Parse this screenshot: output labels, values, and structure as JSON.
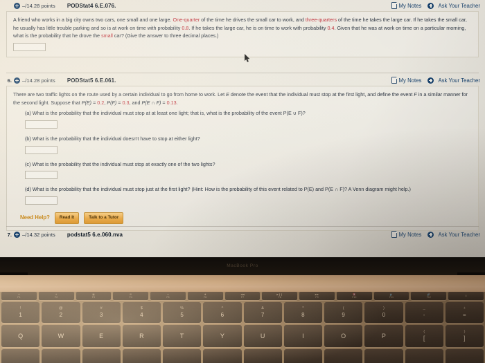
{
  "screen": {
    "questions": [
      {
        "number": "",
        "points": "–/14.28 points",
        "title": "PODStat4 6.E.076.",
        "my_notes": "My Notes",
        "ask_teacher": "Ask Your Teacher",
        "body_parts": [
          {
            "t": "A friend who works in a big city owns two cars, one small and one large. ",
            "style": "plain"
          },
          {
            "t": "One-quarter",
            "style": "hl"
          },
          {
            "t": " of the time he drives the small car to work, and ",
            "style": "plain"
          },
          {
            "t": "three-quarters",
            "style": "hl"
          },
          {
            "t": " of the time he takes the large car. If he takes the small car, he usually has little trouble parking and so is at work on time with probability ",
            "style": "plain"
          },
          {
            "t": "0.8",
            "style": "hl"
          },
          {
            "t": ". If he takes the large car, he is on time to work with probability ",
            "style": "plain"
          },
          {
            "t": "0.4",
            "style": "hl"
          },
          {
            "t": ". Given that he was at work on time on a particular morning, what is the probability that he drove the ",
            "style": "plain"
          },
          {
            "t": "small",
            "style": "hl"
          },
          {
            "t": " car? (Give the answer to three decimal places.)",
            "style": "plain"
          }
        ],
        "answer_value": ""
      },
      {
        "number": "6.",
        "points": "–/14.28 points",
        "title": "PODStat5 6.E.061.",
        "my_notes": "My Notes",
        "ask_teacher": "Ask Your Teacher",
        "intro_parts": [
          {
            "t": "There are two traffic lights on the route used by a certain individual to go from home to work. Let ",
            "style": "plain"
          },
          {
            "t": "E",
            "style": "it"
          },
          {
            "t": " denote the event that the individual must stop at the first light, and define the event ",
            "style": "plain"
          },
          {
            "t": "F",
            "style": "it"
          },
          {
            "t": " in a similar manner for the second light. Suppose that ",
            "style": "plain"
          },
          {
            "t": "P(E)",
            "style": "it"
          },
          {
            "t": " = ",
            "style": "plain"
          },
          {
            "t": "0.2",
            "style": "hl"
          },
          {
            "t": ", ",
            "style": "plain"
          },
          {
            "t": "P(F)",
            "style": "it"
          },
          {
            "t": " = ",
            "style": "plain"
          },
          {
            "t": "0.3",
            "style": "hl"
          },
          {
            "t": ", and ",
            "style": "plain"
          },
          {
            "t": "P(E ∩ F)",
            "style": "it"
          },
          {
            "t": " = ",
            "style": "plain"
          },
          {
            "t": "0.13",
            "style": "hl"
          },
          {
            "t": ".",
            "style": "plain"
          }
        ],
        "parts": [
          {
            "label": "(a)",
            "text": "What is the probability that the individual must stop at at least one light; that is, what is the probability of the event P(E ∪ F)?",
            "answer_value": ""
          },
          {
            "label": "(b)",
            "text": "What is the probability that the individual doesn't have to stop at either light?",
            "answer_value": ""
          },
          {
            "label": "(c)",
            "text": "What is the probability that the individual must stop at exactly one of the two lights?",
            "answer_value": ""
          },
          {
            "label": "(d)",
            "text": "What is the probability that the individual must stop just at the first light? (Hint: How is the probability of this event related to P(E) and P(E ∩ F)? A Venn diagram might help.)",
            "answer_value": ""
          }
        ],
        "need_help_label": "Need Help?",
        "help_buttons": [
          "Read It",
          "Talk to a Tutor"
        ]
      },
      {
        "number": "7.",
        "points": "–/14.32 points",
        "title": "podstat5 6.e.060.nva",
        "my_notes": "My Notes",
        "ask_teacher": "Ask Your Teacher"
      }
    ],
    "colors": {
      "highlight": "#bf2f3a",
      "link": "#17406b",
      "need_help": "#c98a1c"
    }
  },
  "laptop": {
    "bezel_label": "MacBook Pro",
    "fn_row": [
      {
        "glyph": "☀",
        "label": "F1"
      },
      {
        "glyph": "☀",
        "label": "F2"
      },
      {
        "glyph": "▦",
        "label": "F3"
      },
      {
        "glyph": "⊞",
        "label": "F4"
      },
      {
        "glyph": "✶",
        "label": "F5"
      },
      {
        "glyph": "✸",
        "label": "F6"
      },
      {
        "glyph": "◀◀",
        "label": "F7"
      },
      {
        "glyph": "▶❙❙",
        "label": "F8"
      },
      {
        "glyph": "▶▶",
        "label": "F9"
      },
      {
        "glyph": "🔇",
        "label": "F10"
      },
      {
        "glyph": "🔉",
        "label": "F11"
      },
      {
        "glyph": "🔊",
        "label": "F12"
      },
      {
        "glyph": "⏻",
        "label": ""
      }
    ],
    "num_row": [
      {
        "shifted": "!",
        "base": "1"
      },
      {
        "shifted": "@",
        "base": "2"
      },
      {
        "shifted": "#",
        "base": "3"
      },
      {
        "shifted": "$",
        "base": "4"
      },
      {
        "shifted": "%",
        "base": "5"
      },
      {
        "shifted": "^",
        "base": "6"
      },
      {
        "shifted": "&",
        "base": "7"
      },
      {
        "shifted": "*",
        "base": "8"
      },
      {
        "shifted": "(",
        "base": "9"
      },
      {
        "shifted": ")",
        "base": "0"
      },
      {
        "shifted": "_",
        "base": "-"
      },
      {
        "shifted": "+",
        "base": "="
      }
    ],
    "qwerty_row": [
      {
        "base": "Q"
      },
      {
        "base": "W"
      },
      {
        "base": "E"
      },
      {
        "base": "R"
      },
      {
        "base": "T"
      },
      {
        "base": "Y"
      },
      {
        "base": "U"
      },
      {
        "base": "I"
      },
      {
        "base": "O"
      },
      {
        "base": "P"
      },
      {
        "shifted": "{",
        "base": "["
      },
      {
        "shifted": "}",
        "base": "]"
      }
    ]
  }
}
